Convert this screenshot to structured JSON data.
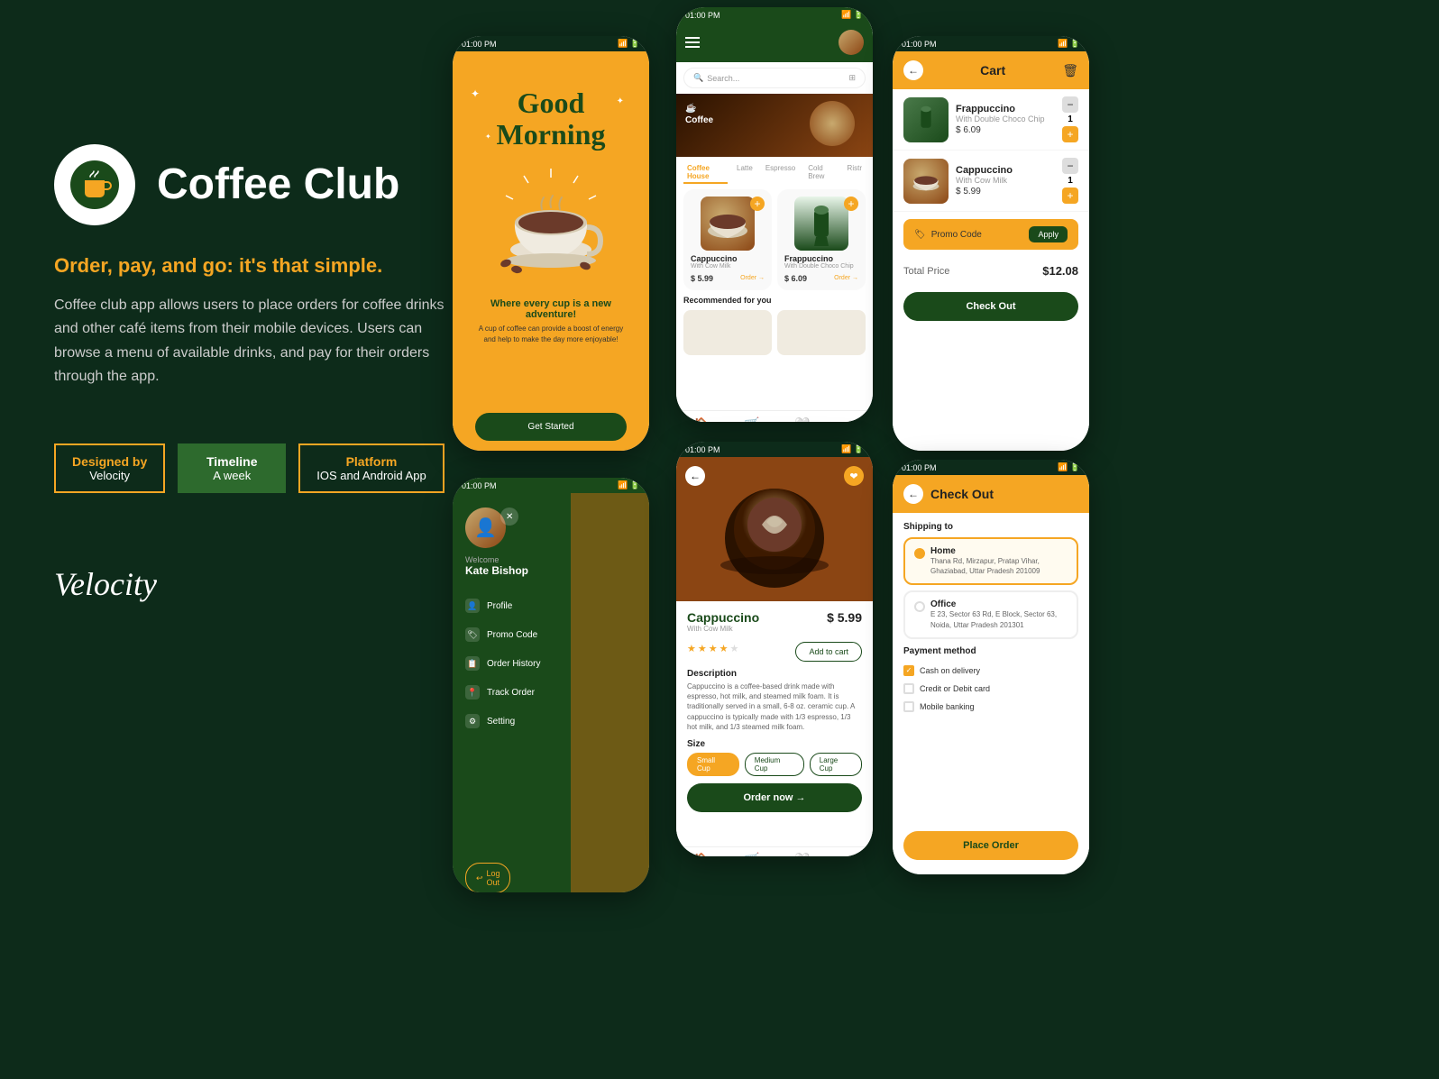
{
  "brand": {
    "name": "Coffee Club",
    "tagline": "Order, pay, and go: it's that simple.",
    "description": "Coffee club app allows users to place orders for coffee drinks and other café items from their mobile devices. Users can browse a menu of available drinks, and pay for their orders through the app.",
    "designer_label": "Designed by",
    "designer_name": "Velocity",
    "timeline_label": "Timeline",
    "timeline_value": "A week",
    "platform_label": "Platform",
    "platform_value": "IOS and Android App",
    "velocity_logo": "Velocity"
  },
  "phone1": {
    "time": "01:00 PM",
    "greeting_line1": "Good",
    "greeting_line2": "Morning",
    "tagline": "Where every cup is a new adventure!",
    "sub": "A cup of coffee can provide a boost of energy and help to make the day more enjoyable!",
    "cta": "Get Started"
  },
  "phone2": {
    "time": "01:00 PM",
    "search_placeholder": "Search...",
    "categories": [
      "Coffee House",
      "Latte",
      "Espresso",
      "Cold Brew",
      "Ristr"
    ],
    "active_category": "Coffee House",
    "items": [
      {
        "name": "Cappuccino",
        "sub": "With Cow Milk",
        "price": "$ 5.99",
        "action": "Order →"
      },
      {
        "name": "Frappuccino",
        "sub": "With Double Choco Chip",
        "price": "$ 6.09",
        "action": "Order →"
      }
    ],
    "recommended_label": "Recommended for you"
  },
  "phone3": {
    "time": "01:00 PM",
    "title": "Cart",
    "items": [
      {
        "name": "Frappuccino",
        "sub": "With Double Choco Chip",
        "price": "$ 6.09",
        "qty": 1
      },
      {
        "name": "Cappuccino",
        "sub": "With Cow Milk",
        "price": "$ 5.99",
        "qty": 1
      }
    ],
    "promo_label": "Promo Code",
    "promo_btn": "Apply",
    "total_label": "Total Price",
    "total_amount": "$12.08",
    "checkout_btn": "Check Out"
  },
  "phone4": {
    "time": "01:00 PM",
    "welcome": "Welcome",
    "name": "Kate Bishop",
    "menu": [
      "Profile",
      "Promo Code",
      "Order History",
      "Track Order",
      "Setting"
    ],
    "logout": "Log Out"
  },
  "phone5": {
    "time": "01:00 PM",
    "product_name": "Cappuccino",
    "product_sub": "With Cow Milk",
    "product_price": "$ 5.99",
    "stars": 3.5,
    "add_to_cart": "Add to cart",
    "desc_title": "Description",
    "desc_text": "Cappuccino is a coffee-based drink made with espresso, hot milk, and steamed milk foam. It is traditionally served in a small, 6-8 oz. ceramic cup. A cappuccino is typically made with 1/3 espresso, 1/3 hot milk, and 1/3 steamed milk foam.",
    "size_title": "Size",
    "sizes": [
      "Small Cup",
      "Medium Cup",
      "Large Cup"
    ],
    "active_size": "Small Cup",
    "order_btn": "Order now →"
  },
  "phone6": {
    "time": "01:00 PM",
    "title": "Check Out",
    "shipping_label": "Shipping to",
    "addresses": [
      {
        "label": "Home",
        "text": "Thana Rd, Mirzapur, Pratap Vihar, Ghaziabad, Uttar Pradesh 201009",
        "selected": true
      },
      {
        "label": "Office",
        "text": "E 23, Sector 63 Rd, E Block, Sector 63, Noida, Uttar Pradesh 201301",
        "selected": false
      }
    ],
    "payment_label": "Payment method",
    "payment_options": [
      {
        "label": "Cash on delivery",
        "checked": true
      },
      {
        "label": "Credit or Debit card",
        "checked": false
      },
      {
        "label": "Mobile banking",
        "checked": false
      }
    ],
    "place_order_btn": "Place Order"
  }
}
